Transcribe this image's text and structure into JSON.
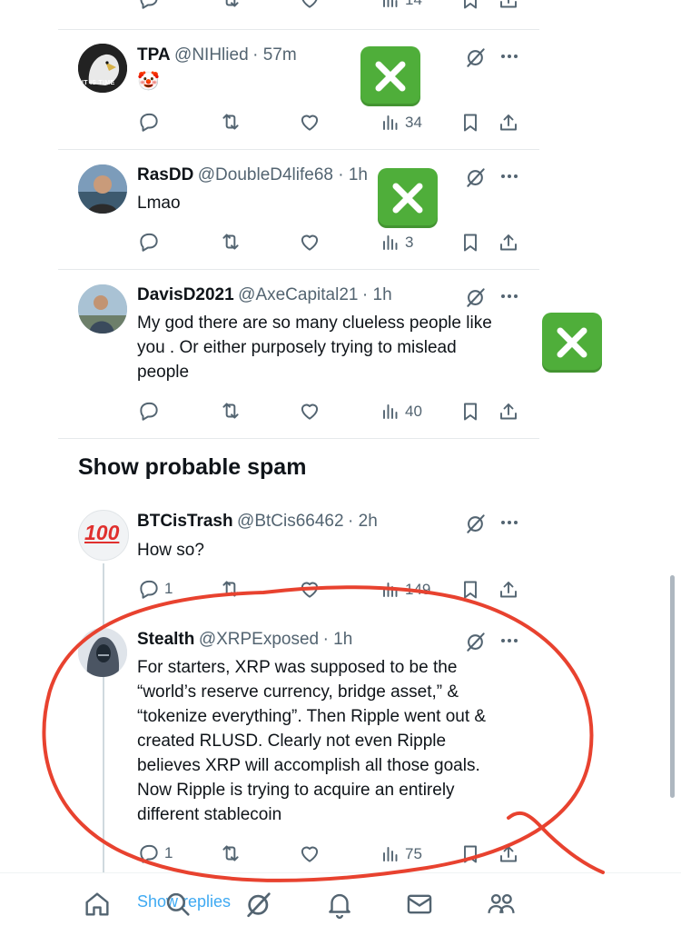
{
  "tweets": [
    {
      "name": "TPA",
      "handle": "@NIHlied",
      "time": "· 57m",
      "text": "🤡",
      "avatar_text": "IT IS TIME",
      "replies": "",
      "reposts": "",
      "likes": "",
      "views": "34"
    },
    {
      "name": "RasDD",
      "handle": "@DoubleD4life68 · 1h",
      "time": "",
      "text": "Lmao",
      "replies": "",
      "reposts": "",
      "likes": "",
      "views": "3"
    },
    {
      "name": "DavisD2021",
      "handle": "@AxeCapital21",
      "time": "· 1h",
      "text_lines": [
        "My god there are so many clueless people like",
        "you .  Or either purposely trying to mislead",
        "people"
      ],
      "replies": "",
      "reposts": "",
      "likes": "",
      "views": "40"
    },
    {
      "name": "BTCisTrash",
      "handle": "@BtCis66462",
      "time": "· 2h",
      "text": "How so?",
      "avatar_text": "100",
      "replies": "1",
      "reposts": "",
      "likes": "",
      "views": "149"
    },
    {
      "name": "Stealth",
      "handle": "@XRPExposed",
      "time": "· 1h",
      "text_lines": [
        "For starters, XRP was supposed to be the",
        "“world’s reserve currency, bridge asset,” &",
        "“tokenize everything”. Then Ripple went out &",
        "created RLUSD. Clearly not even Ripple",
        "believes XRP will accomplish all those goals.",
        "Now Ripple is trying to acquire an entirely",
        "different stablecoin"
      ],
      "replies": "1",
      "reposts": "",
      "likes": "",
      "views": "75"
    }
  ],
  "top_partial": {
    "views": "14"
  },
  "section_header": "Show probable spam",
  "show_replies": "Show replies",
  "colors": {
    "accent": "#1d9bf0",
    "annotation_red": "#e8422f",
    "xmark_green": "#4fae3a",
    "text_secondary": "#536471"
  },
  "icons": [
    "reply-icon",
    "repost-icon",
    "like-icon",
    "views-icon",
    "bookmark-icon",
    "share-icon",
    "grok-icon",
    "more-icon",
    "home-icon",
    "search-icon",
    "bell-icon",
    "mail-icon",
    "communities-icon",
    "cross-mark-icon"
  ]
}
